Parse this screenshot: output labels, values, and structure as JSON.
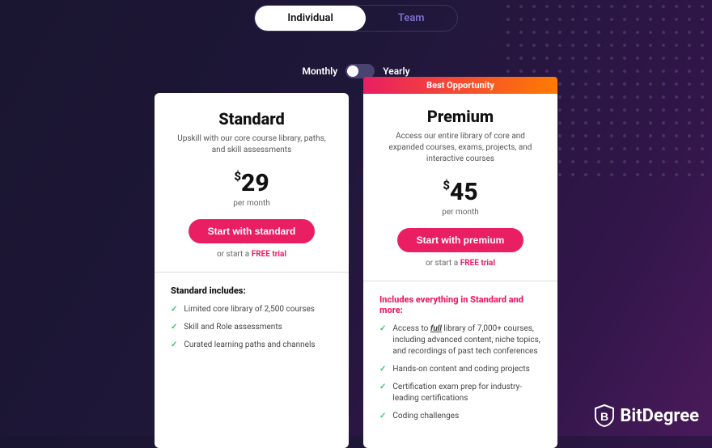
{
  "tabs": {
    "individual": "Individual",
    "team": "Team"
  },
  "billing": {
    "monthly": "Monthly",
    "yearly": "Yearly"
  },
  "standard": {
    "title": "Standard",
    "desc": "Upskill with our core course library, paths, and skill assessments",
    "currency": "$",
    "price": "29",
    "unit": "per month",
    "cta": "Start with standard",
    "trial_prefix": "or start a ",
    "trial_link": "FREE trial",
    "includes_title": "Standard includes:",
    "features": [
      "Limited core library of 2,500 courses",
      "Skill and Role assessments",
      "Curated learning paths and channels"
    ]
  },
  "premium": {
    "badge": "Best Opportunity",
    "title": "Premium",
    "desc": "Access our entire library of core and expanded courses, exams, projects, and interactive courses",
    "currency": "$",
    "price": "45",
    "unit": "per month",
    "cta": "Start with premium",
    "trial_prefix": "or start a ",
    "trial_link": "FREE trial",
    "includes_title": "Includes everything in Standard and more:",
    "feature1_prefix": "Access to ",
    "feature1_full": "full",
    "feature1_suffix": " library of 7,000+ courses, including advanced content, niche topics, and recordings of past tech conferences",
    "features_rest": [
      "Hands-on content and coding projects",
      "Certification exam prep for industry-leading certifications",
      "Coding challenges"
    ]
  },
  "logo": "BitDegree"
}
